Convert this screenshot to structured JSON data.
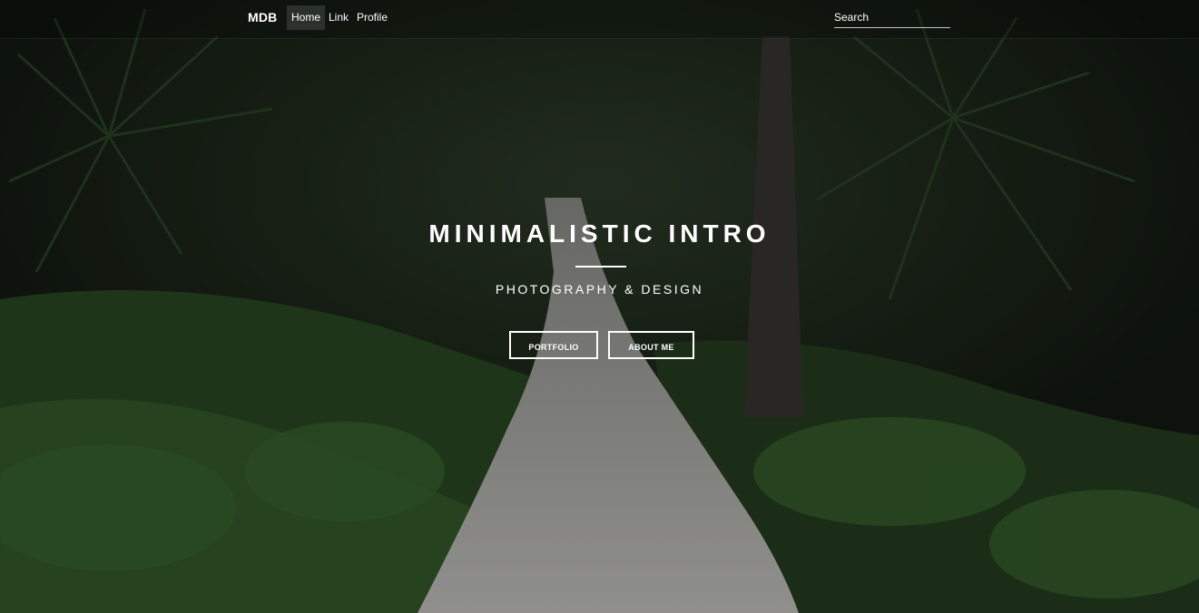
{
  "navbar": {
    "brand": "MDB",
    "items": [
      {
        "label": "Home",
        "active": true
      },
      {
        "label": "Link",
        "active": false
      },
      {
        "label": "Profile",
        "active": false
      }
    ],
    "search_placeholder": "Search"
  },
  "hero": {
    "title": "MINIMALISTIC INTRO",
    "subtitle": "PHOTOGRAPHY & DESIGN",
    "buttons": [
      {
        "label": "PORTFOLIO"
      },
      {
        "label": "ABOUT ME"
      }
    ]
  },
  "colors": {
    "foliage_dark": "#1d2a1b",
    "path_gravel": "#a9a9a7",
    "text": "#ffffff"
  }
}
